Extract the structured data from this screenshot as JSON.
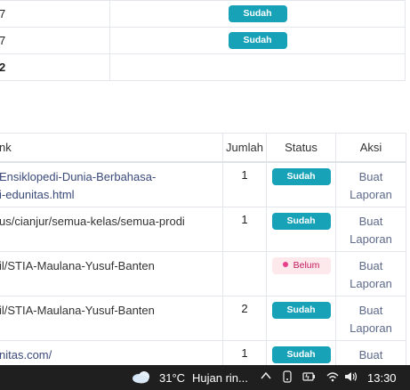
{
  "top_rows": [
    {
      "col1": "7",
      "status": "Sudah"
    },
    {
      "col1": "7",
      "status": "Sudah"
    },
    {
      "col1": "2",
      "status": ""
    }
  ],
  "headers": {
    "link": "nk",
    "jumlah": "Jumlah",
    "status": "Status",
    "aksi": "Aksi"
  },
  "rows": [
    {
      "link1": "Ensiklopedi-Dunia-Berbahasa-",
      "link2": "i-edunitas.html",
      "jumlah": "1",
      "status": "Sudah",
      "aksi1": "Buat",
      "aksi2": "Laporan"
    },
    {
      "link1": "us/cianjur/semua-kelas/semua-prodi",
      "link2": "",
      "jumlah": "1",
      "status": "Sudah",
      "aksi1": "Buat",
      "aksi2": "Laporan"
    },
    {
      "link1": "il/STIA-Maulana-Yusuf-Banten",
      "link2": "",
      "jumlah": "",
      "status": "Belum",
      "aksi1": "Buat",
      "aksi2": "Laporan"
    },
    {
      "link1": "il/STIA-Maulana-Yusuf-Banten",
      "link2": "",
      "jumlah": "2",
      "status": "Sudah",
      "aksi1": "Buat",
      "aksi2": "Laporan"
    },
    {
      "link1": "nitas.com/",
      "link2": "",
      "jumlah": "1",
      "status": "Sudah",
      "aksi1": "Buat",
      "aksi2": ""
    }
  ],
  "taskbar": {
    "weather_icon": "cloud-sun-icon",
    "temperature": "31°C",
    "weather": "Hujan rin...",
    "chevron": "^",
    "time": "13:30"
  }
}
